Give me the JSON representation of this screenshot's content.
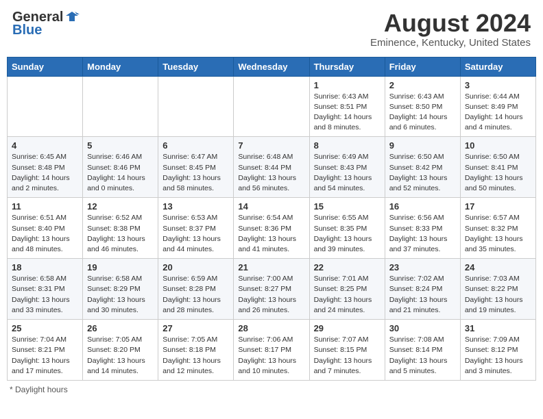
{
  "header": {
    "logo_line1": "General",
    "logo_line2": "Blue",
    "month_title": "August 2024",
    "location": "Eminence, Kentucky, United States"
  },
  "columns": [
    "Sunday",
    "Monday",
    "Tuesday",
    "Wednesday",
    "Thursday",
    "Friday",
    "Saturday"
  ],
  "footer": "Daylight hours",
  "weeks": [
    [
      {
        "day": "",
        "info": ""
      },
      {
        "day": "",
        "info": ""
      },
      {
        "day": "",
        "info": ""
      },
      {
        "day": "",
        "info": ""
      },
      {
        "day": "1",
        "info": "Sunrise: 6:43 AM\nSunset: 8:51 PM\nDaylight: 14 hours and 8 minutes."
      },
      {
        "day": "2",
        "info": "Sunrise: 6:43 AM\nSunset: 8:50 PM\nDaylight: 14 hours and 6 minutes."
      },
      {
        "day": "3",
        "info": "Sunrise: 6:44 AM\nSunset: 8:49 PM\nDaylight: 14 hours and 4 minutes."
      }
    ],
    [
      {
        "day": "4",
        "info": "Sunrise: 6:45 AM\nSunset: 8:48 PM\nDaylight: 14 hours and 2 minutes."
      },
      {
        "day": "5",
        "info": "Sunrise: 6:46 AM\nSunset: 8:46 PM\nDaylight: 14 hours and 0 minutes."
      },
      {
        "day": "6",
        "info": "Sunrise: 6:47 AM\nSunset: 8:45 PM\nDaylight: 13 hours and 58 minutes."
      },
      {
        "day": "7",
        "info": "Sunrise: 6:48 AM\nSunset: 8:44 PM\nDaylight: 13 hours and 56 minutes."
      },
      {
        "day": "8",
        "info": "Sunrise: 6:49 AM\nSunset: 8:43 PM\nDaylight: 13 hours and 54 minutes."
      },
      {
        "day": "9",
        "info": "Sunrise: 6:50 AM\nSunset: 8:42 PM\nDaylight: 13 hours and 52 minutes."
      },
      {
        "day": "10",
        "info": "Sunrise: 6:50 AM\nSunset: 8:41 PM\nDaylight: 13 hours and 50 minutes."
      }
    ],
    [
      {
        "day": "11",
        "info": "Sunrise: 6:51 AM\nSunset: 8:40 PM\nDaylight: 13 hours and 48 minutes."
      },
      {
        "day": "12",
        "info": "Sunrise: 6:52 AM\nSunset: 8:38 PM\nDaylight: 13 hours and 46 minutes."
      },
      {
        "day": "13",
        "info": "Sunrise: 6:53 AM\nSunset: 8:37 PM\nDaylight: 13 hours and 44 minutes."
      },
      {
        "day": "14",
        "info": "Sunrise: 6:54 AM\nSunset: 8:36 PM\nDaylight: 13 hours and 41 minutes."
      },
      {
        "day": "15",
        "info": "Sunrise: 6:55 AM\nSunset: 8:35 PM\nDaylight: 13 hours and 39 minutes."
      },
      {
        "day": "16",
        "info": "Sunrise: 6:56 AM\nSunset: 8:33 PM\nDaylight: 13 hours and 37 minutes."
      },
      {
        "day": "17",
        "info": "Sunrise: 6:57 AM\nSunset: 8:32 PM\nDaylight: 13 hours and 35 minutes."
      }
    ],
    [
      {
        "day": "18",
        "info": "Sunrise: 6:58 AM\nSunset: 8:31 PM\nDaylight: 13 hours and 33 minutes."
      },
      {
        "day": "19",
        "info": "Sunrise: 6:58 AM\nSunset: 8:29 PM\nDaylight: 13 hours and 30 minutes."
      },
      {
        "day": "20",
        "info": "Sunrise: 6:59 AM\nSunset: 8:28 PM\nDaylight: 13 hours and 28 minutes."
      },
      {
        "day": "21",
        "info": "Sunrise: 7:00 AM\nSunset: 8:27 PM\nDaylight: 13 hours and 26 minutes."
      },
      {
        "day": "22",
        "info": "Sunrise: 7:01 AM\nSunset: 8:25 PM\nDaylight: 13 hours and 24 minutes."
      },
      {
        "day": "23",
        "info": "Sunrise: 7:02 AM\nSunset: 8:24 PM\nDaylight: 13 hours and 21 minutes."
      },
      {
        "day": "24",
        "info": "Sunrise: 7:03 AM\nSunset: 8:22 PM\nDaylight: 13 hours and 19 minutes."
      }
    ],
    [
      {
        "day": "25",
        "info": "Sunrise: 7:04 AM\nSunset: 8:21 PM\nDaylight: 13 hours and 17 minutes."
      },
      {
        "day": "26",
        "info": "Sunrise: 7:05 AM\nSunset: 8:20 PM\nDaylight: 13 hours and 14 minutes."
      },
      {
        "day": "27",
        "info": "Sunrise: 7:05 AM\nSunset: 8:18 PM\nDaylight: 13 hours and 12 minutes."
      },
      {
        "day": "28",
        "info": "Sunrise: 7:06 AM\nSunset: 8:17 PM\nDaylight: 13 hours and 10 minutes."
      },
      {
        "day": "29",
        "info": "Sunrise: 7:07 AM\nSunset: 8:15 PM\nDaylight: 13 hours and 7 minutes."
      },
      {
        "day": "30",
        "info": "Sunrise: 7:08 AM\nSunset: 8:14 PM\nDaylight: 13 hours and 5 minutes."
      },
      {
        "day": "31",
        "info": "Sunrise: 7:09 AM\nSunset: 8:12 PM\nDaylight: 13 hours and 3 minutes."
      }
    ]
  ]
}
